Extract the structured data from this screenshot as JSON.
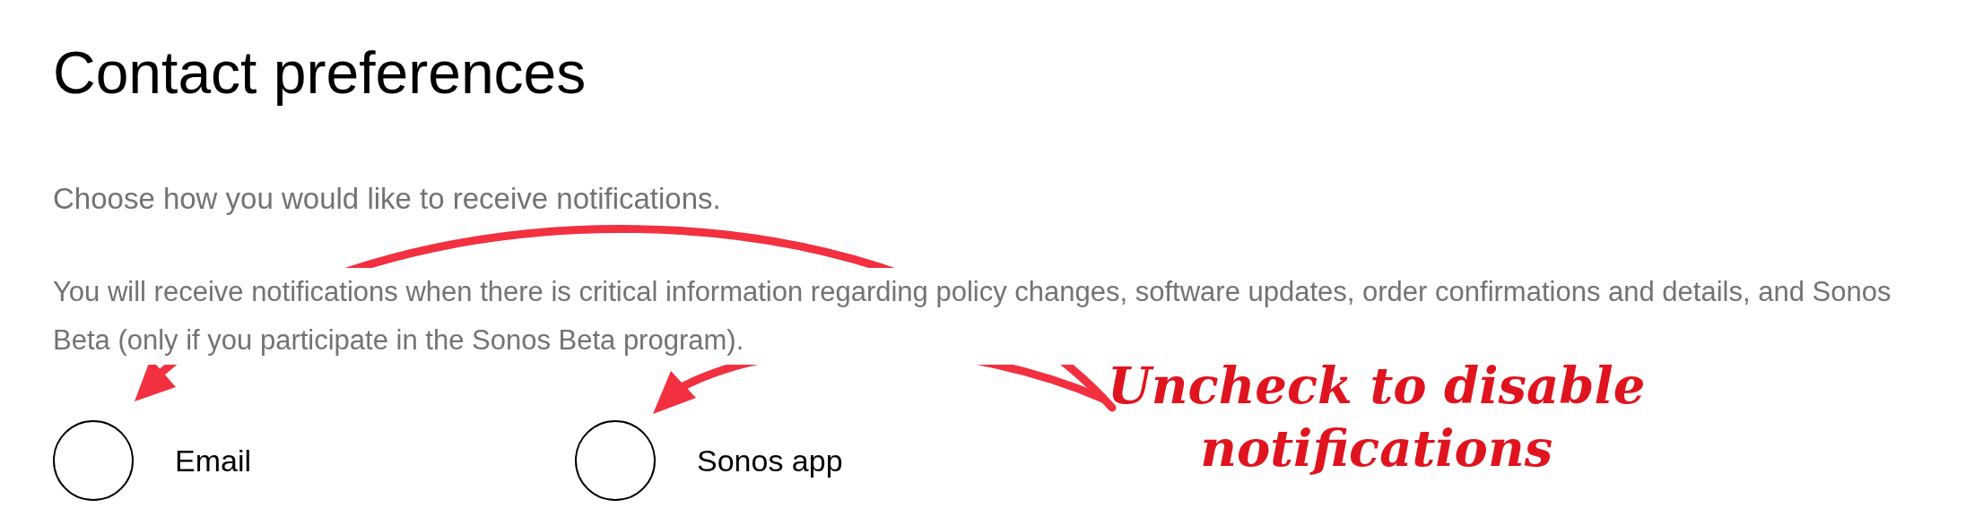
{
  "heading": "Contact preferences",
  "intro": "Choose how you would like to receive notifications.",
  "notice": "You will receive notifications when there is critical information regarding policy changes, software updates, order confirmations and details, and Sonos Beta (only if you participate in the Sonos Beta program).",
  "options": [
    {
      "label": "Email",
      "checked": false
    },
    {
      "label": "Sonos app",
      "checked": false
    }
  ],
  "annotation": {
    "lines": [
      "Uncheck to disable",
      "notifications"
    ]
  }
}
